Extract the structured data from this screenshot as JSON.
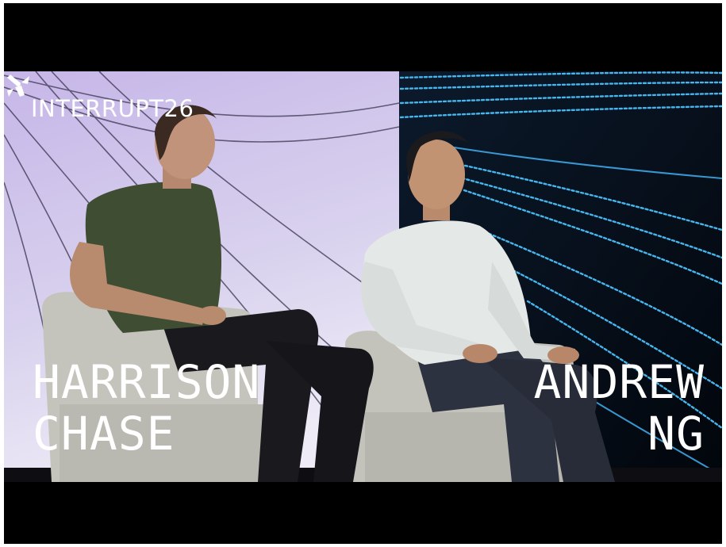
{
  "video": {
    "event_title": "INTERRUPT26",
    "logo_icon": "langchain-parrot-link-icon",
    "speakers": [
      {
        "first": "HARRISON",
        "last": "CHASE"
      },
      {
        "first": "ANDREW",
        "last": "NG"
      }
    ]
  },
  "colors": {
    "letterbox": "#000000",
    "left_backdrop": "#c9bfe6",
    "right_backdrop": "#050a12",
    "light_lines": "#48b8f0",
    "caption_text": "#ffffff"
  }
}
